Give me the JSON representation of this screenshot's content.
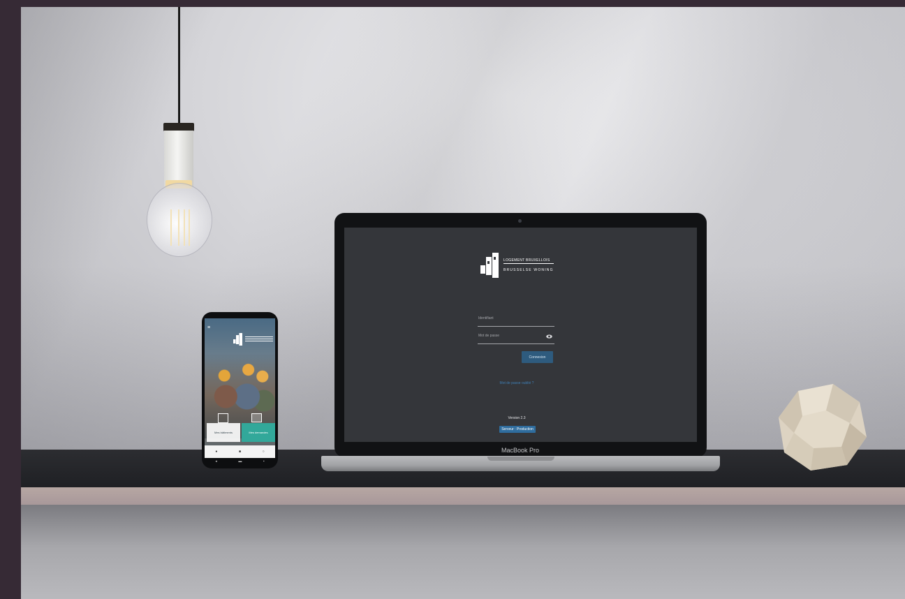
{
  "laptop": {
    "brand": "MacBook Pro",
    "app": {
      "logo_line1": "LOGEMENT BRUXELLOIS",
      "logo_line2": "BRUSSELSE WONING",
      "username_placeholder": "Identifiant",
      "password_placeholder": "Mot de passe",
      "login_button": "Connexion",
      "forgot_link": "Mot de passe oublié ?",
      "version": "Version 2.3",
      "environment": "Serveur : Production"
    }
  },
  "phone": {
    "menu_icon": "menu-icon",
    "tile_left": {
      "label": "Mes bâtiments",
      "icon": "building-icon"
    },
    "tile_right": {
      "label": "Mes demandes",
      "icon": "message-icon"
    },
    "nav_icons": [
      "home-icon",
      "building-icon",
      "search-icon"
    ],
    "system_icons": [
      "back-icon",
      "home-button-icon",
      "recent-apps-icon"
    ]
  },
  "colors": {
    "frame": "#362a35",
    "screen_bg": "#34363a",
    "login_button": "#2e5b7e",
    "link": "#3f7fb5",
    "tile_accent": "#32a89a"
  }
}
